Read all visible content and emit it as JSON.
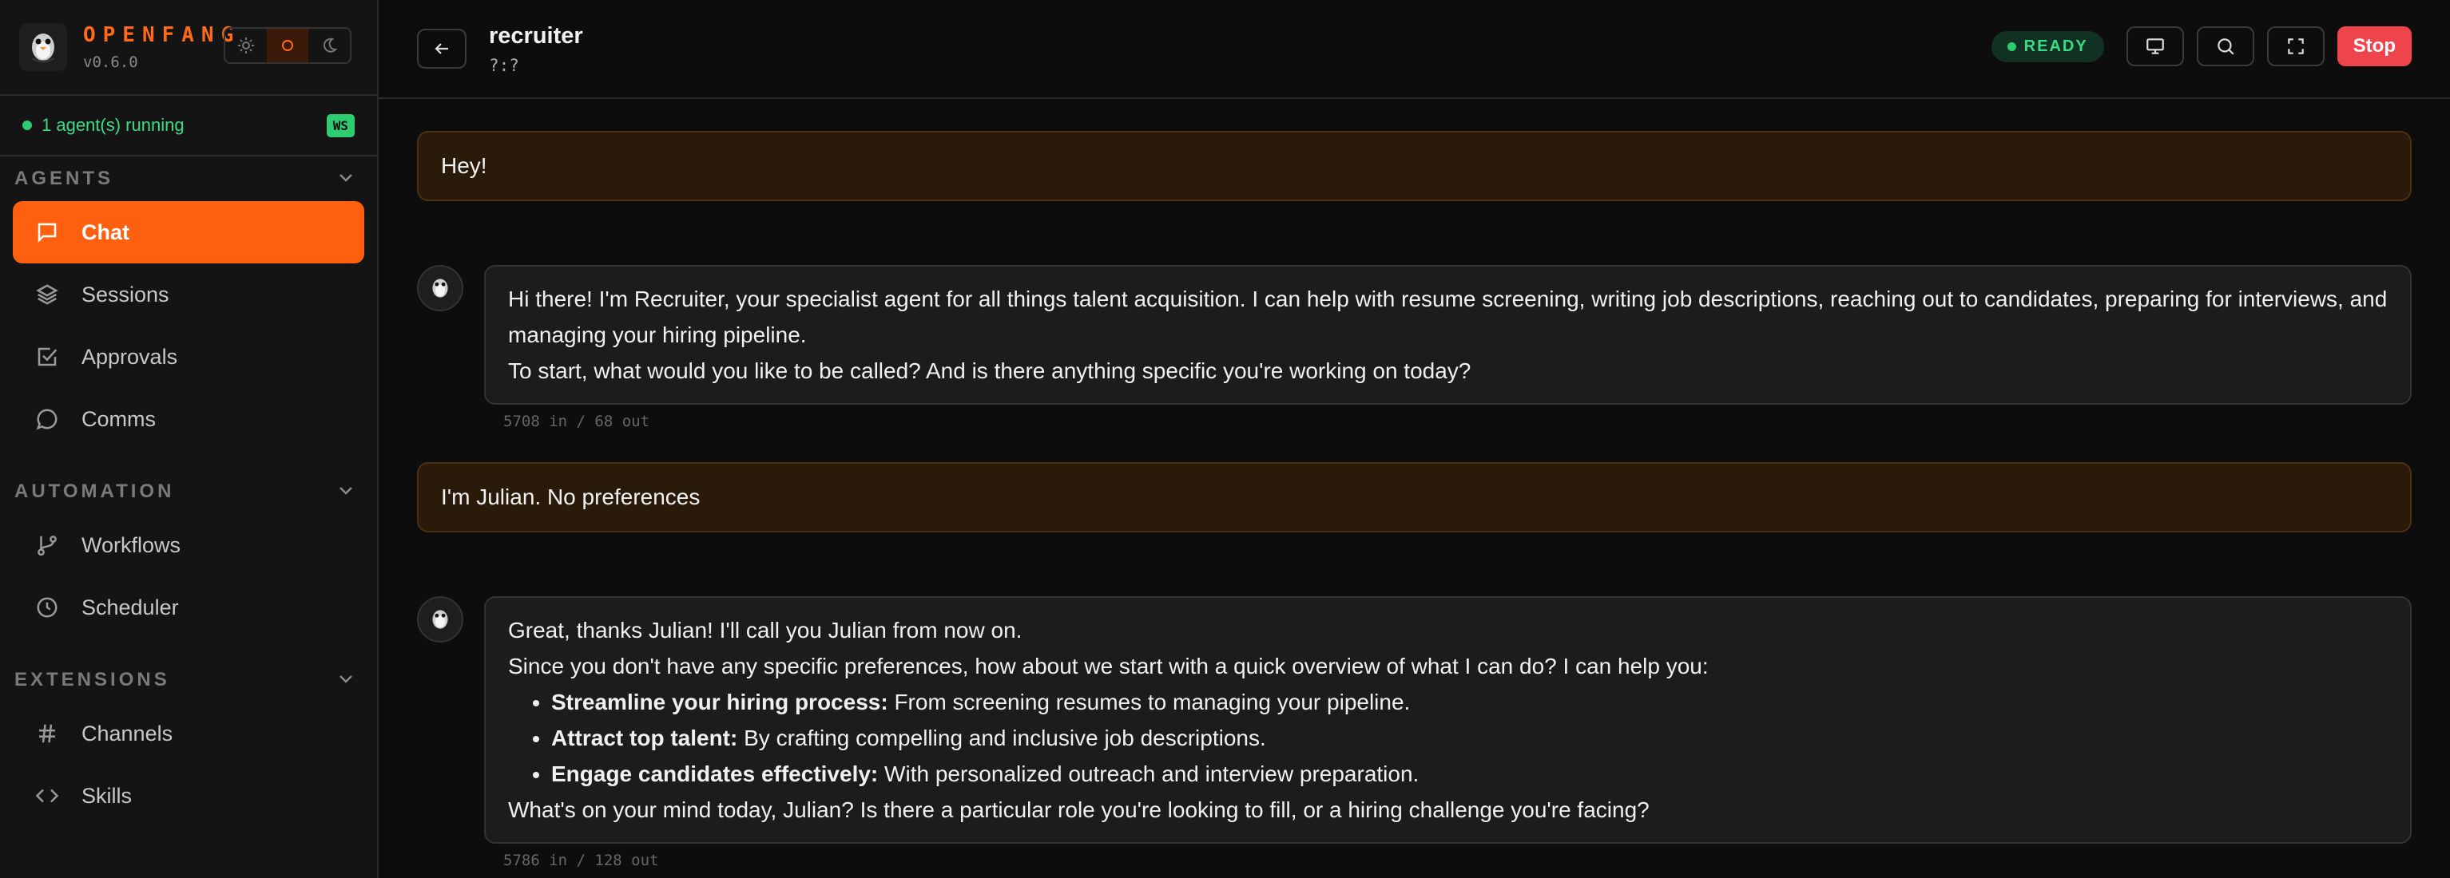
{
  "brand": {
    "name": "OPENFANG",
    "version": "v0.6.0"
  },
  "theme_toggle": {
    "options": [
      "light",
      "system",
      "dark"
    ],
    "active": "system"
  },
  "status": {
    "text": "1 agent(s) running",
    "badge": "WS"
  },
  "sidebar": {
    "sections": [
      {
        "title": "AGENTS",
        "items": [
          {
            "label": "Chat",
            "icon": "chat-icon",
            "active": true
          },
          {
            "label": "Sessions",
            "icon": "layers-icon"
          },
          {
            "label": "Approvals",
            "icon": "checkbox-icon"
          },
          {
            "label": "Comms",
            "icon": "speech-bubble-icon"
          }
        ]
      },
      {
        "title": "AUTOMATION",
        "items": [
          {
            "label": "Workflows",
            "icon": "branch-icon"
          },
          {
            "label": "Scheduler",
            "icon": "clock-icon"
          }
        ]
      },
      {
        "title": "EXTENSIONS",
        "items": [
          {
            "label": "Channels",
            "icon": "hash-icon"
          },
          {
            "label": "Skills",
            "icon": "code-icon"
          }
        ]
      }
    ]
  },
  "header": {
    "agent_name": "recruiter",
    "agent_sub": "?:?",
    "status": "READY",
    "stop_label": "Stop"
  },
  "colors": {
    "accent": "#ff6010",
    "ready": "#3ddc84",
    "stop": "#f0444c"
  },
  "messages": [
    {
      "role": "user",
      "text": "Hey!"
    },
    {
      "role": "agent",
      "lines": [
        "Hi there! I'm Recruiter, your specialist agent for all things talent acquisition. I can help with resume screening, writing job descriptions, reaching out to candidates, preparing for interviews, and managing your hiring pipeline.",
        "To start, what would you like to be called? And is there anything specific you're working on today?"
      ],
      "tokens": "5708 in / 68 out"
    },
    {
      "role": "user",
      "text": "I'm Julian. No preferences"
    },
    {
      "role": "agent",
      "intro": [
        "Great, thanks Julian! I'll call you Julian from now on.",
        "Since you don't have any specific preferences, how about we start with a quick overview of what I can do? I can help you:"
      ],
      "bullets": [
        {
          "bold": "Streamline your hiring process:",
          "text": " From screening resumes to managing your pipeline."
        },
        {
          "bold": "Attract top talent:",
          "text": " By crafting compelling and inclusive job descriptions."
        },
        {
          "bold": "Engage candidates effectively:",
          "text": " With personalized outreach and interview preparation."
        }
      ],
      "outro": "What's on your mind today, Julian? Is there a particular role you're looking to fill, or a hiring challenge you're facing?",
      "tokens": "5786 in / 128 out"
    }
  ]
}
